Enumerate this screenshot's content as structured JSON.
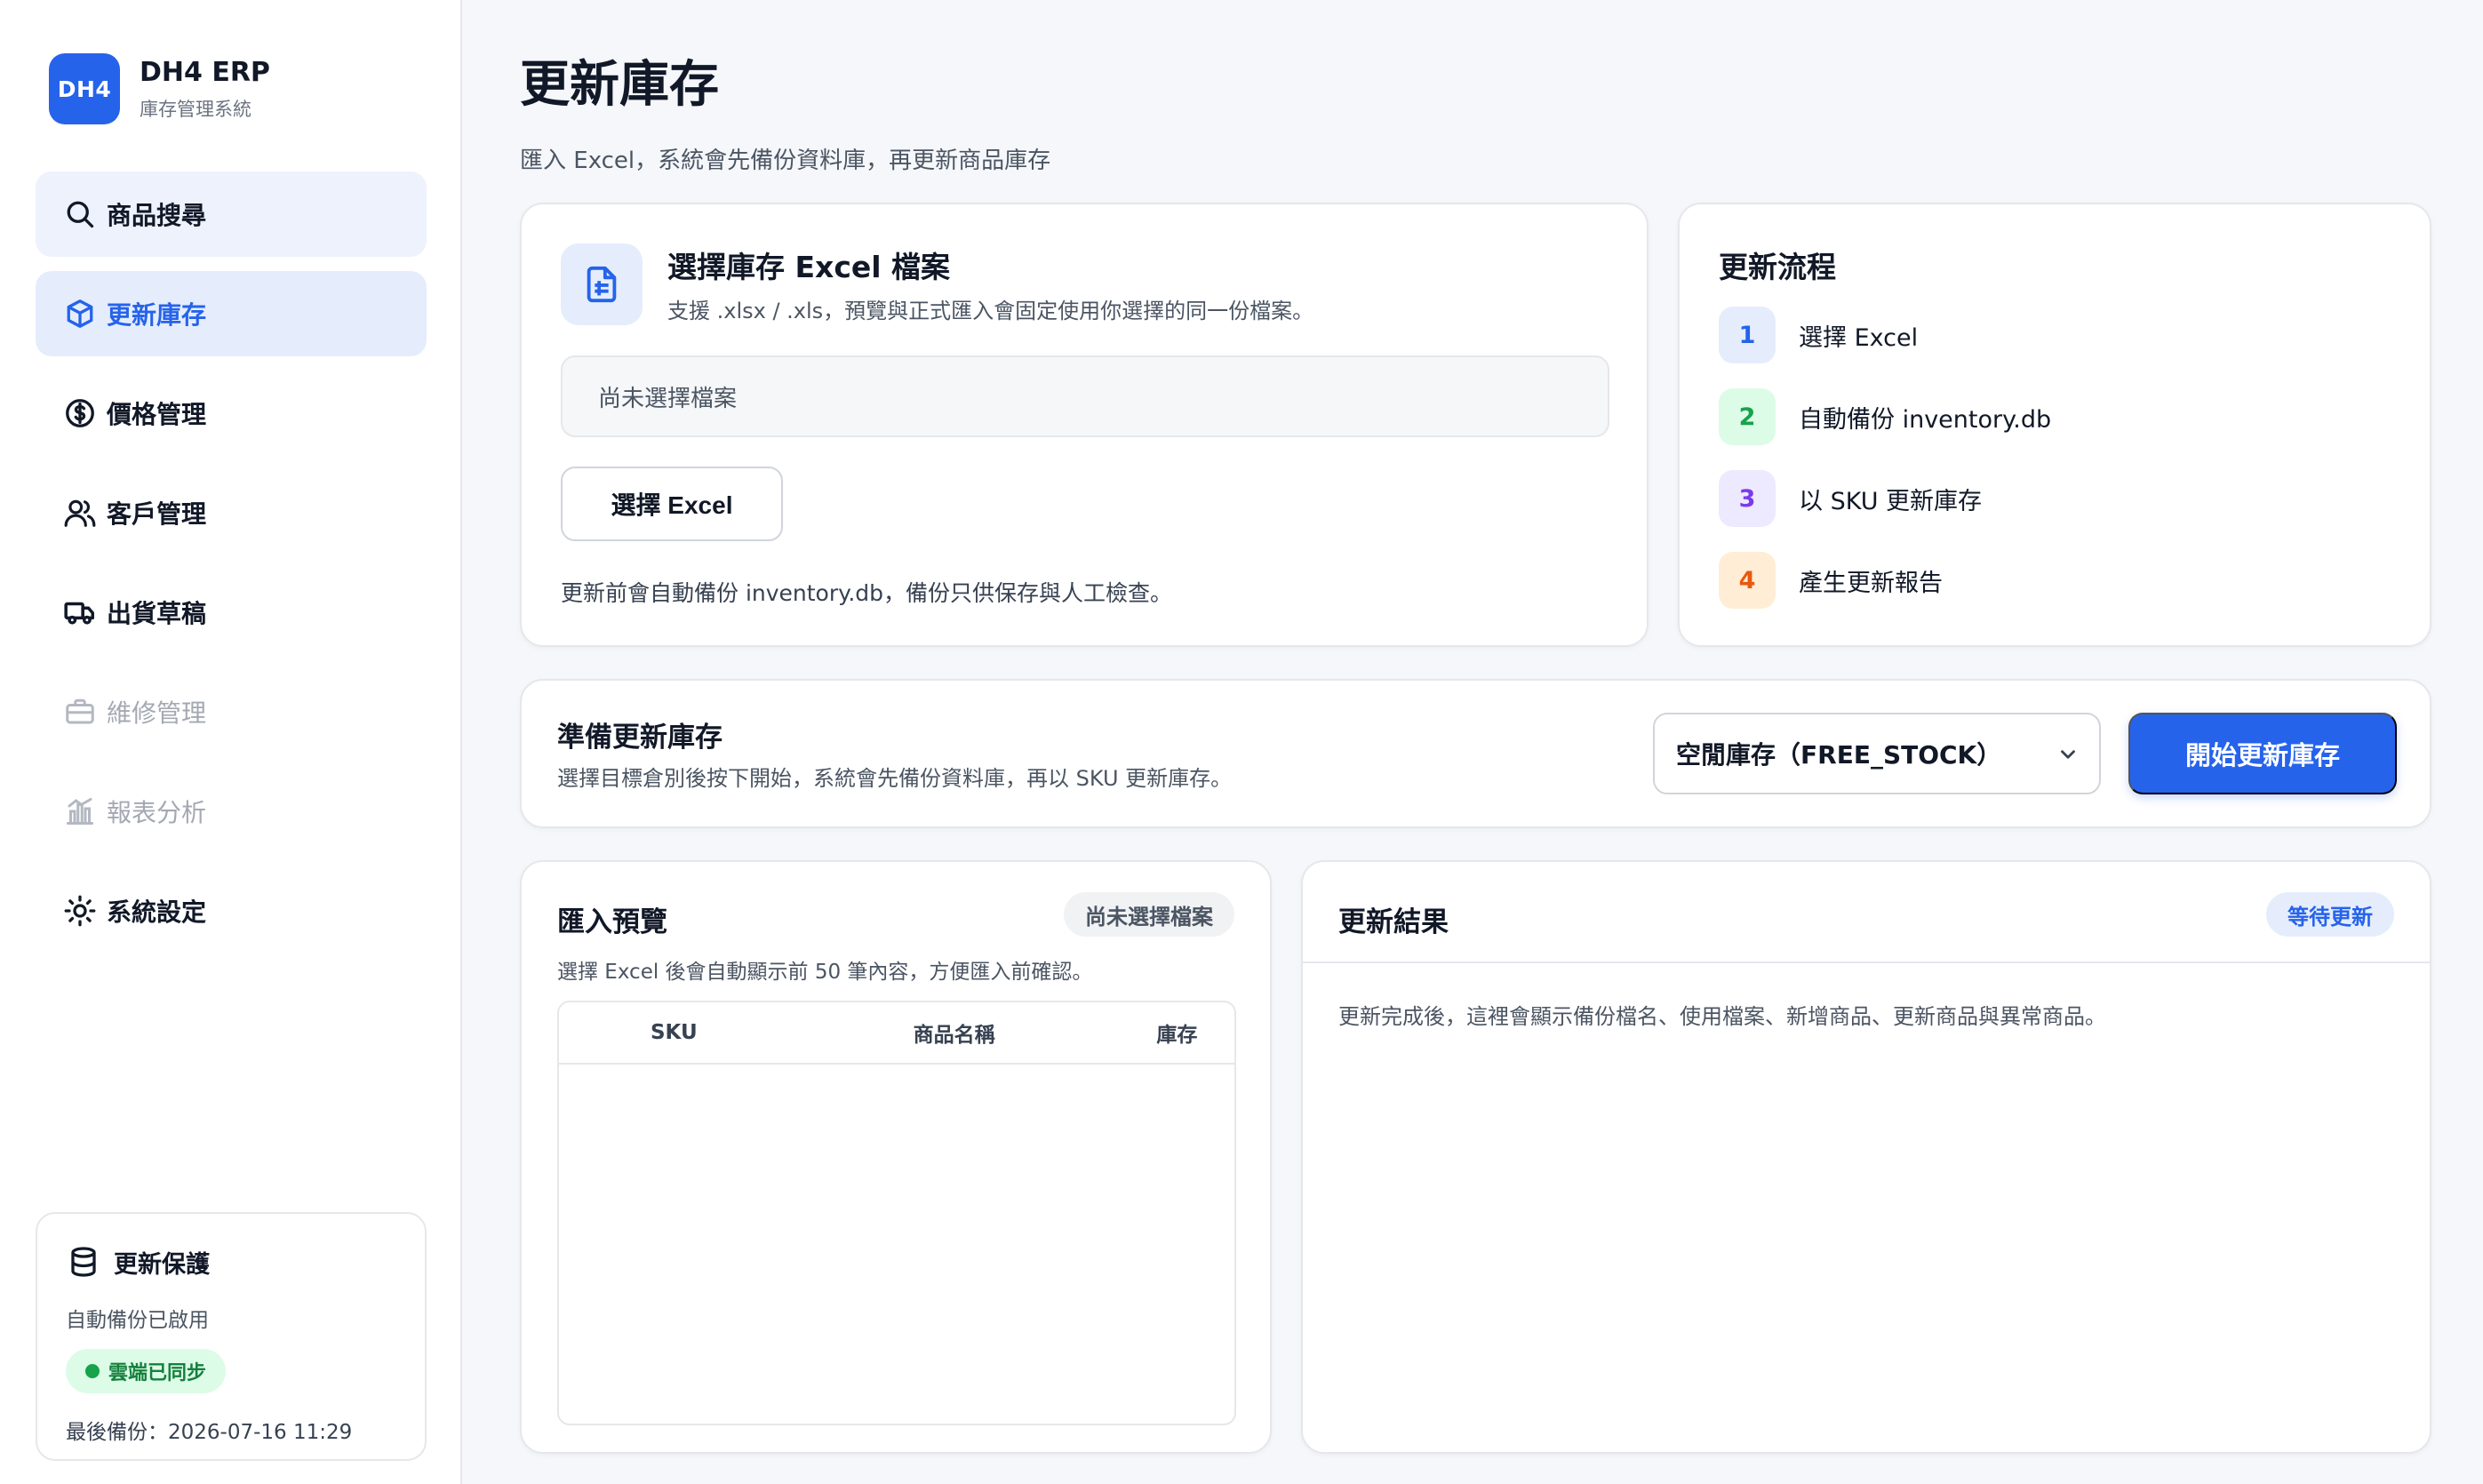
{
  "brand": {
    "logo_text": "DH4",
    "name": "DH4 ERP",
    "subtitle": "庫存管理系統"
  },
  "sidebar": {
    "items": [
      {
        "label": "商品搜尋",
        "icon": "search-icon",
        "state": "hover"
      },
      {
        "label": "更新庫存",
        "icon": "box-icon",
        "state": "active"
      },
      {
        "label": "價格管理",
        "icon": "dollar-circle-icon",
        "state": "normal"
      },
      {
        "label": "客戶管理",
        "icon": "users-icon",
        "state": "normal"
      },
      {
        "label": "出貨草稿",
        "icon": "truck-icon",
        "state": "normal"
      },
      {
        "label": "維修管理",
        "icon": "briefcase-icon",
        "state": "disabled"
      },
      {
        "label": "報表分析",
        "icon": "chart-icon",
        "state": "disabled"
      },
      {
        "label": "系統設定",
        "icon": "sun-gear-icon",
        "state": "normal"
      }
    ],
    "protection": {
      "title": "更新保護",
      "icon": "database-icon",
      "status": "自動備份已啟用",
      "badge": "雲端已同步",
      "last_backup": "最後備份：2026-07-16 11:29"
    }
  },
  "page": {
    "title": "更新庫存",
    "subtitle": "匯入 Excel，系統會先備份資料庫，再更新商品庫存"
  },
  "file_select": {
    "icon": "spreadsheet-file-icon",
    "title": "選擇庫存 Excel 檔案",
    "description": "支援 .xlsx / .xls，預覽與正式匯入會固定使用你選擇的同一份檔案。",
    "file_value": "尚未選擇檔案",
    "button_label": "選擇 Excel",
    "note": "更新前會自動備份 inventory.db，備份只供保存與人工檢查。"
  },
  "flow": {
    "title": "更新流程",
    "steps": [
      {
        "num": "1",
        "label": "選擇 Excel",
        "color": "#2563eb",
        "bg": "#e5edfc"
      },
      {
        "num": "2",
        "label": "自動備份 inventory.db",
        "color": "#16a34a",
        "bg": "#dcfce7"
      },
      {
        "num": "3",
        "label": "以 SKU 更新庫存",
        "color": "#7c3aed",
        "bg": "#ede9fe"
      },
      {
        "num": "4",
        "label": "產生更新報告",
        "color": "#ea580c",
        "bg": "#ffedd5"
      }
    ]
  },
  "prepare": {
    "title": "準備更新庫存",
    "description": "選擇目標倉別後按下開始，系統會先備份資料庫，再以 SKU 更新庫存。",
    "warehouse_selected": "空閒庫存（FREE_STOCK）",
    "start_label": "開始更新庫存"
  },
  "preview": {
    "title": "匯入預覽",
    "badge": "尚未選擇檔案",
    "description": "選擇 Excel 後會自動顯示前 50 筆內容，方便匯入前確認。",
    "columns": [
      "SKU",
      "商品名稱",
      "庫存"
    ],
    "rows": []
  },
  "result": {
    "title": "更新結果",
    "badge": "等待更新",
    "description": "更新完成後，這裡會顯示備份檔名、使用檔案、新增商品、更新商品與異常商品。"
  },
  "colors": {
    "accent": "#2563eb",
    "active_bg": "#e5edfc",
    "success": "#16a34a"
  }
}
